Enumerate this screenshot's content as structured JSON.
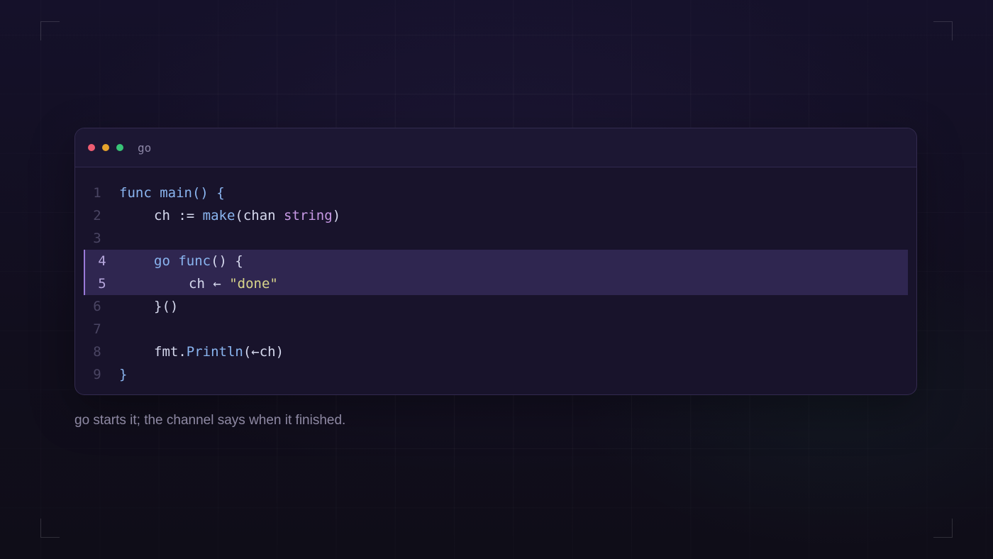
{
  "window": {
    "language": "go"
  },
  "code": {
    "lines": [
      {
        "num": "1",
        "parts": [
          "func",
          " main() {"
        ]
      },
      {
        "num": "2",
        "parts": [
          "ch := ",
          "make",
          "(chan ",
          "string",
          ")"
        ]
      },
      {
        "num": "3",
        "parts": []
      },
      {
        "num": "4",
        "parts": [
          "go",
          " ",
          "func",
          "() {"
        ]
      },
      {
        "num": "5",
        "parts": [
          "ch ← ",
          "\"done\""
        ]
      },
      {
        "num": "6",
        "parts": [
          "}()"
        ]
      },
      {
        "num": "7",
        "parts": []
      },
      {
        "num": "8",
        "parts": [
          "fmt.",
          "Println",
          "(←ch)"
        ]
      },
      {
        "num": "9",
        "parts": [
          "}"
        ]
      }
    ],
    "highlighted_lines": [
      "4",
      "5"
    ]
  },
  "caption": "go starts it; the channel says when it finished.",
  "colors": {
    "keyword": "#8ab5f0",
    "type": "#c89ae6",
    "string": "#d9d58a",
    "highlight": "#2f2650",
    "highlight_bar": "#9a79d8"
  }
}
